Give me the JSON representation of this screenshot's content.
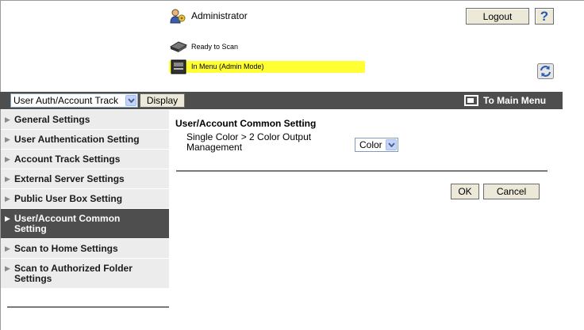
{
  "header": {
    "user_label": "Administrator",
    "logout_label": "Logout",
    "help_label": "?",
    "status_ready": "Ready to Scan",
    "status_mode": "In Menu (Admin Mode)"
  },
  "navbar": {
    "mode_select_value": "User Auth/Account Track",
    "display_label": "Display",
    "main_menu_label": "To Main Menu"
  },
  "sidebar": {
    "items": [
      {
        "label": "General Settings",
        "active": false
      },
      {
        "label": "User Authentication Setting",
        "active": false
      },
      {
        "label": "Account Track Settings",
        "active": false
      },
      {
        "label": "External Server Settings",
        "active": false
      },
      {
        "label": "Public User Box Setting",
        "active": false
      },
      {
        "label": "User/Account Common Setting",
        "active": true
      },
      {
        "label": "Scan to Home Settings",
        "active": false
      },
      {
        "label": "Scan to Authorized Folder Settings",
        "active": false
      }
    ]
  },
  "content": {
    "title": "User/Account Common Setting",
    "setting_label": "Single Color > 2 Color Output Management",
    "setting_value": "Color",
    "ok_label": "OK",
    "cancel_label": "Cancel"
  },
  "colors": {
    "nav_bg": "#4e4e4e",
    "sidebar_bg": "#ececec",
    "sidebar_active_bg": "#4e4e4e",
    "status_highlight": "#ffff33",
    "button_bg": "#ece9d8"
  }
}
